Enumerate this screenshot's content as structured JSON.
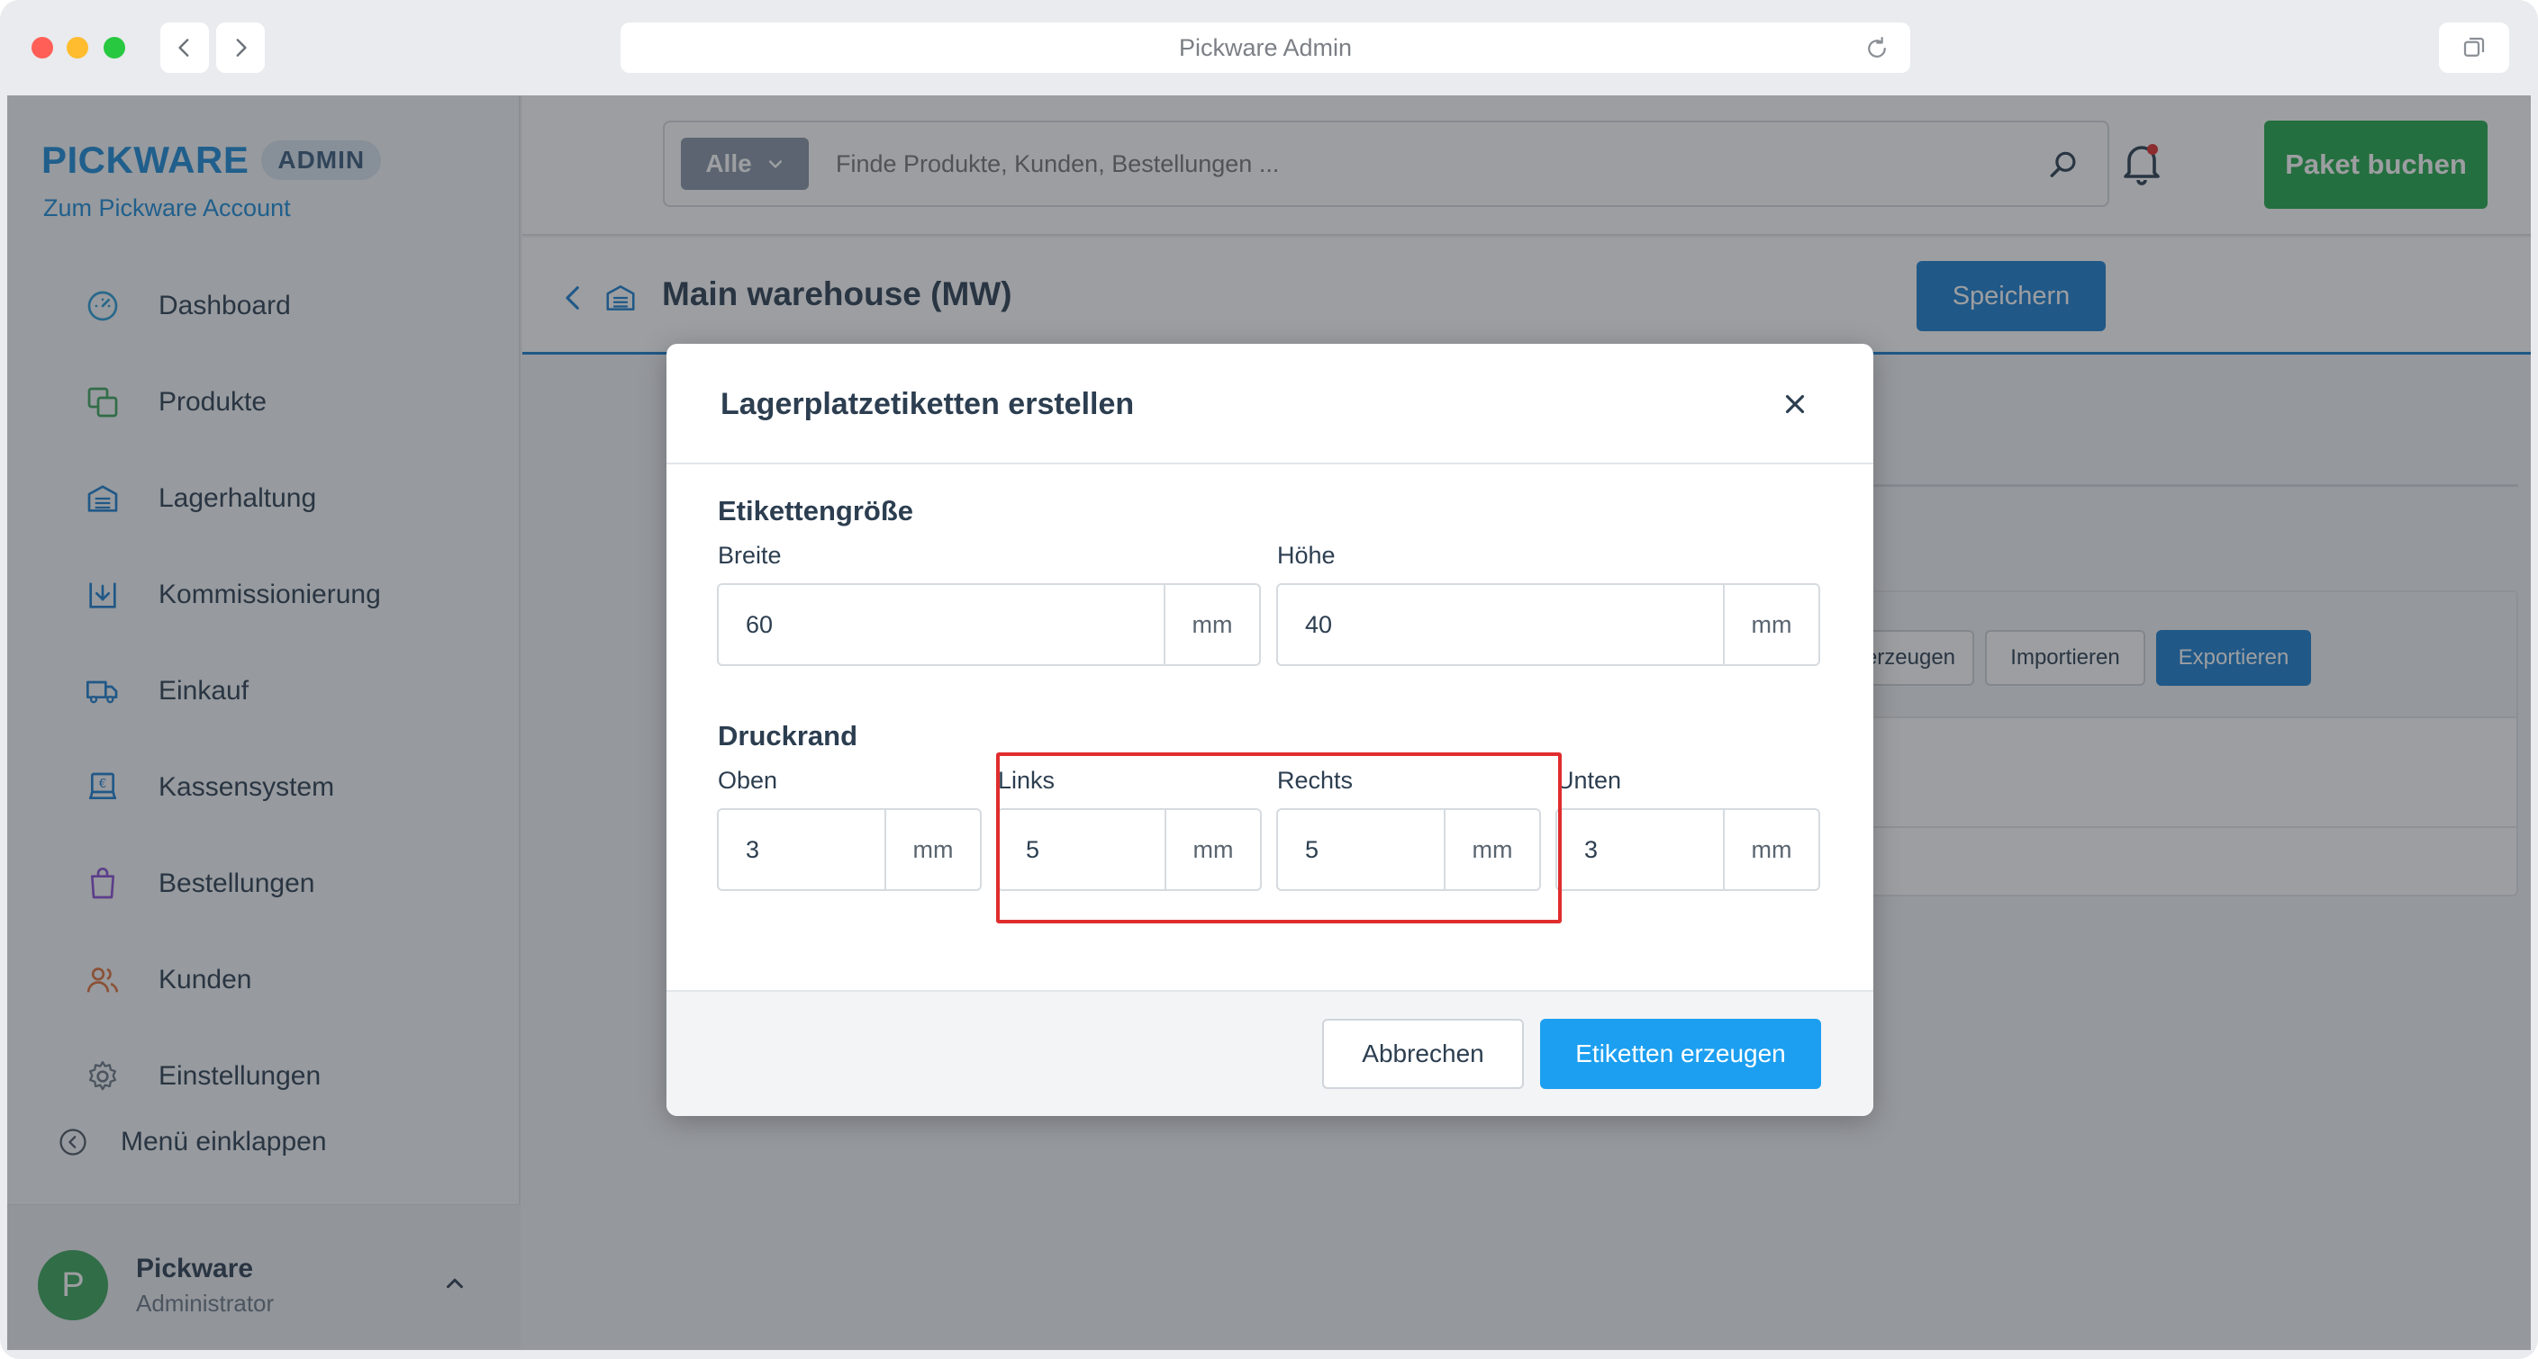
{
  "browser": {
    "url_title": "Pickware Admin"
  },
  "sidebar": {
    "brand_name": "PICKWARE",
    "brand_badge": "ADMIN",
    "account_link": "Zum Pickware Account",
    "items": [
      {
        "label": "Dashboard",
        "icon": "gauge-icon"
      },
      {
        "label": "Produkte",
        "icon": "boxes-icon"
      },
      {
        "label": "Lagerhaltung",
        "icon": "warehouse-icon"
      },
      {
        "label": "Kommissionierung",
        "icon": "tray-download-icon"
      },
      {
        "label": "Einkauf",
        "icon": "truck-icon"
      },
      {
        "label": "Kassensystem",
        "icon": "pos-terminal-icon"
      },
      {
        "label": "Bestellungen",
        "icon": "shopping-bag-icon"
      },
      {
        "label": "Kunden",
        "icon": "users-icon"
      },
      {
        "label": "Einstellungen",
        "icon": "gear-icon"
      }
    ],
    "collapse_label": "Menü einklappen",
    "user": {
      "avatar_letter": "P",
      "name": "Pickware",
      "role": "Administrator"
    }
  },
  "topbar": {
    "search_scope": "Alle",
    "search_placeholder": "Finde Produkte, Kunden, Bestellungen ...",
    "primary_button": "Paket buchen"
  },
  "page": {
    "title": "Main warehouse (MW)",
    "save_button": "Speichern"
  },
  "background_card": {
    "buttons": [
      "erzeugen",
      "Importieren",
      "Exportieren"
    ],
    "more_label": "..."
  },
  "modal": {
    "title": "Lagerplatzetiketten erstellen",
    "size_section": "Etikettengröße",
    "width_label": "Breite",
    "width_value": "60",
    "height_label": "Höhe",
    "height_value": "40",
    "margin_section": "Druckrand",
    "top_label": "Oben",
    "top_value": "3",
    "left_label": "Links",
    "left_value": "5",
    "right_label": "Rechts",
    "right_value": "5",
    "bottom_label": "Unten",
    "bottom_value": "3",
    "unit": "mm",
    "cancel_button": "Abbrechen",
    "confirm_button": "Etiketten erzeugen"
  },
  "colors": {
    "brand_blue": "#1a8bd8",
    "primary_green": "#22a84a",
    "action_blue": "#1c9ff0",
    "highlight_red": "#e02d2d"
  }
}
